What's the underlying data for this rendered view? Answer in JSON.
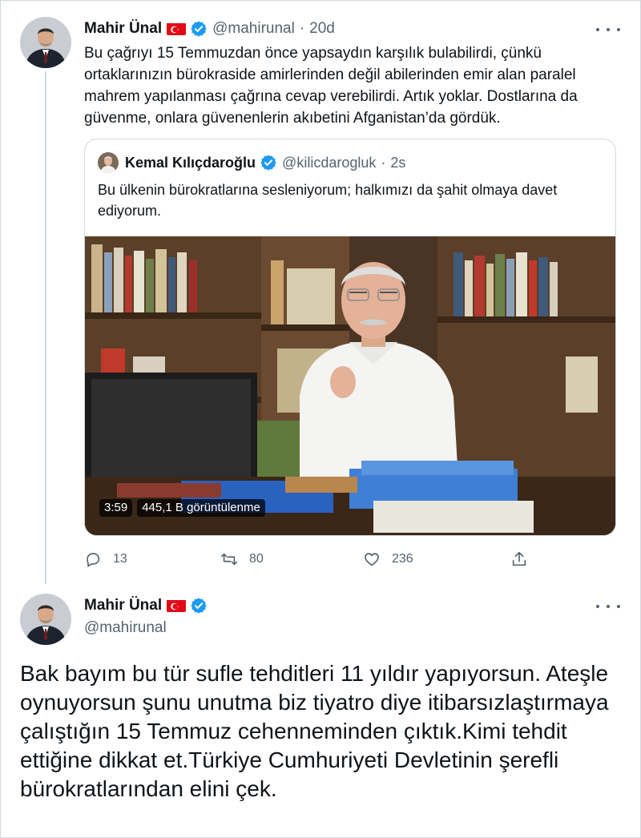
{
  "tweet1": {
    "author_name": "Mahir Ünal",
    "handle": "@mahirunal",
    "time": "20d",
    "text": "Bu çağrıyı 15 Temmuzdan önce yapsaydın karşılık bulabilirdi, çünkü ortaklarınızın bürokraside amirlerinden değil abilerinden emir alan paralel mahrem yapılanması çağrına cevap verebilirdi. Artık yoklar. Dostlarına da güvenme, onlara güvenenlerin akıbetini Afganistan’da gördük.",
    "quoted": {
      "author_name": "Kemal Kılıçdaroğlu",
      "handle": "@kilicdarogluk",
      "time": "2s",
      "text": "Bu ülkenin bürokratlarına sesleniyorum; halkımızı da şahit olmaya davet ediyorum.",
      "video_duration": "3:59",
      "video_views": "445,1 B görüntülenme"
    },
    "actions": {
      "replies": "13",
      "retweets": "80",
      "likes": "236"
    }
  },
  "tweet2": {
    "author_name": "Mahir Ünal",
    "handle": "@mahirunal",
    "text": "Bak bayım bu tür sufle tehditleri 11 yıldır yapıyorsun. Ateşle oynuyorsun şunu unutma biz tiyatro diye itibarsızlaştırmaya çalıştığın 15 Temmuz cehenneminden çıktık.Kimi tehdit ettiğine dikkat et.Türkiye Cumhuriyeti Devletinin şerefli bürokratlarından elini çek."
  },
  "icons": [
    "more-icon",
    "verified-badge-icon",
    "turkey-flag-icon",
    "reply-icon",
    "retweet-icon",
    "like-icon",
    "share-icon"
  ],
  "colors": {
    "verified_blue": "#1d9bf0",
    "flag_red": "#e30a17",
    "secondary_text": "#536471",
    "border": "#cfd9de"
  }
}
